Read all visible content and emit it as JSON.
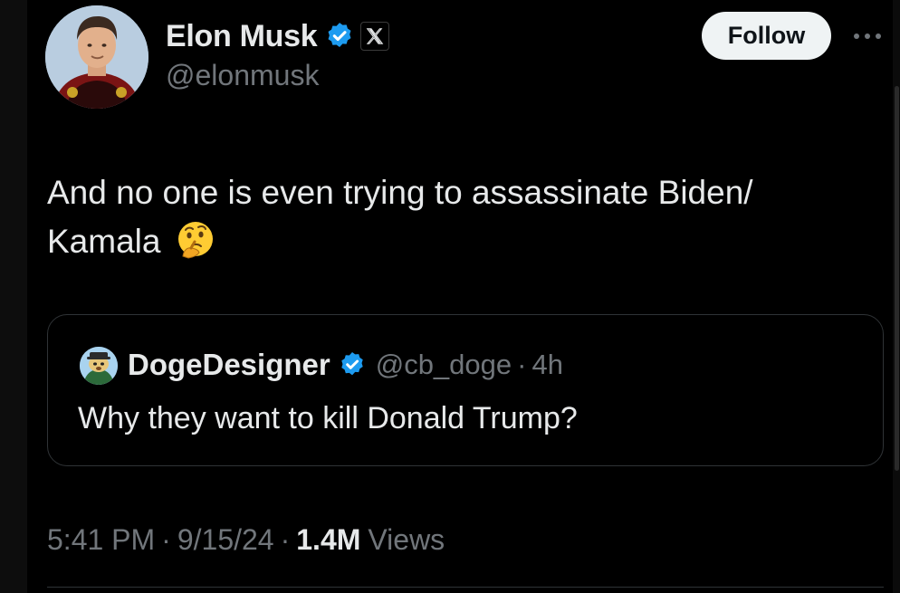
{
  "author": {
    "display_name": "Elon Musk",
    "handle": "@elonmusk",
    "verified_color": "#1d9bf0",
    "affiliate_badge_icon": "x-logo-icon"
  },
  "actions": {
    "follow_label": "Follow",
    "more_icon": "more-dots-icon"
  },
  "tweet": {
    "text": "And no one is even trying to assassinate Biden/",
    "text_line2": "Kamala",
    "emoji": "thinking-face-icon"
  },
  "quoted_tweet": {
    "display_name": "DogeDesigner",
    "handle": "@cb_doge",
    "separator": "·",
    "time": "4h",
    "text": "Why they want to kill Donald Trump?"
  },
  "meta": {
    "time": "5:41 PM",
    "separator": "·",
    "date": "9/15/24",
    "views_count": "1.4M",
    "views_label": "Views"
  },
  "colors": {
    "background": "#000000",
    "text_primary": "#e7e9ea",
    "text_secondary": "#71767b",
    "border": "#2f3336",
    "button_bg": "#eff3f4",
    "accent": "#1d9bf0"
  }
}
